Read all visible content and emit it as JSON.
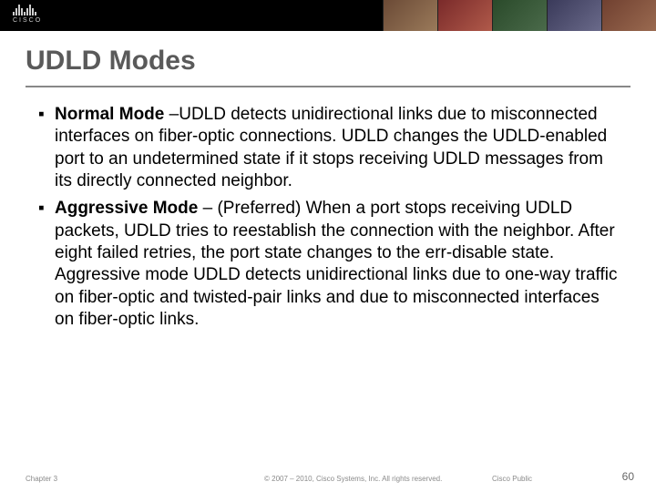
{
  "header": {
    "logo_text": "CISCO"
  },
  "title": "UDLD Modes",
  "bullets": [
    {
      "bold": "Normal Mode",
      "sep": " –",
      "rest": "UDLD detects unidirectional links due to misconnected interfaces on fiber-optic connections. UDLD changes the UDLD-enabled port to an undetermined state if it stops receiving UDLD messages from its directly connected neighbor."
    },
    {
      "bold": "Aggressive Mode",
      "sep": " – ",
      "rest": "(Preferred) When a port stops receiving UDLD packets, UDLD tries to reestablish the connection with the neighbor. After eight failed retries, the port state changes to the err-disable state. Aggressive mode UDLD detects unidirectional links due to one-way traffic on fiber-optic and twisted-pair links and due to misconnected interfaces on fiber-optic links."
    }
  ],
  "footer": {
    "chapter": "Chapter 3",
    "copyright": "© 2007 – 2010, Cisco Systems, Inc. All rights reserved.",
    "public": "Cisco Public",
    "page": "60"
  }
}
